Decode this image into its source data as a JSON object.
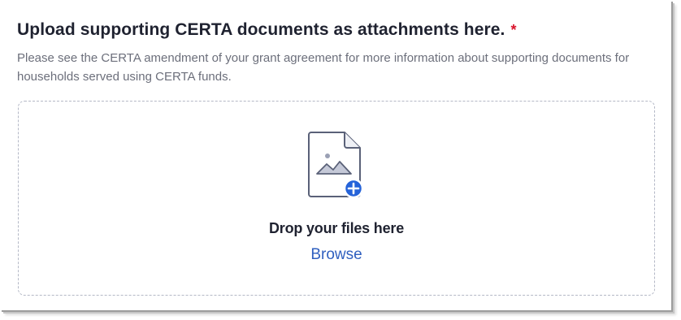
{
  "upload_field": {
    "title": "Upload supporting CERTA documents as attachments here.",
    "required_marker": "*",
    "description": "Please see the CERTA amendment of your grant agreement for more information about supporting documents for households served using CERTA funds.",
    "dropzone": {
      "icon": "image-file-add-icon",
      "drop_label": "Drop your files here",
      "browse_label": "Browse"
    }
  },
  "colors": {
    "title_text": "#1f2230",
    "required": "#d9132b",
    "description_text": "#6c6f7b",
    "dropzone_border": "#b4b8c6",
    "icon_outline": "#5a6178",
    "accent_blue": "#2f5fbf",
    "plus_badge": "#2563d9"
  }
}
